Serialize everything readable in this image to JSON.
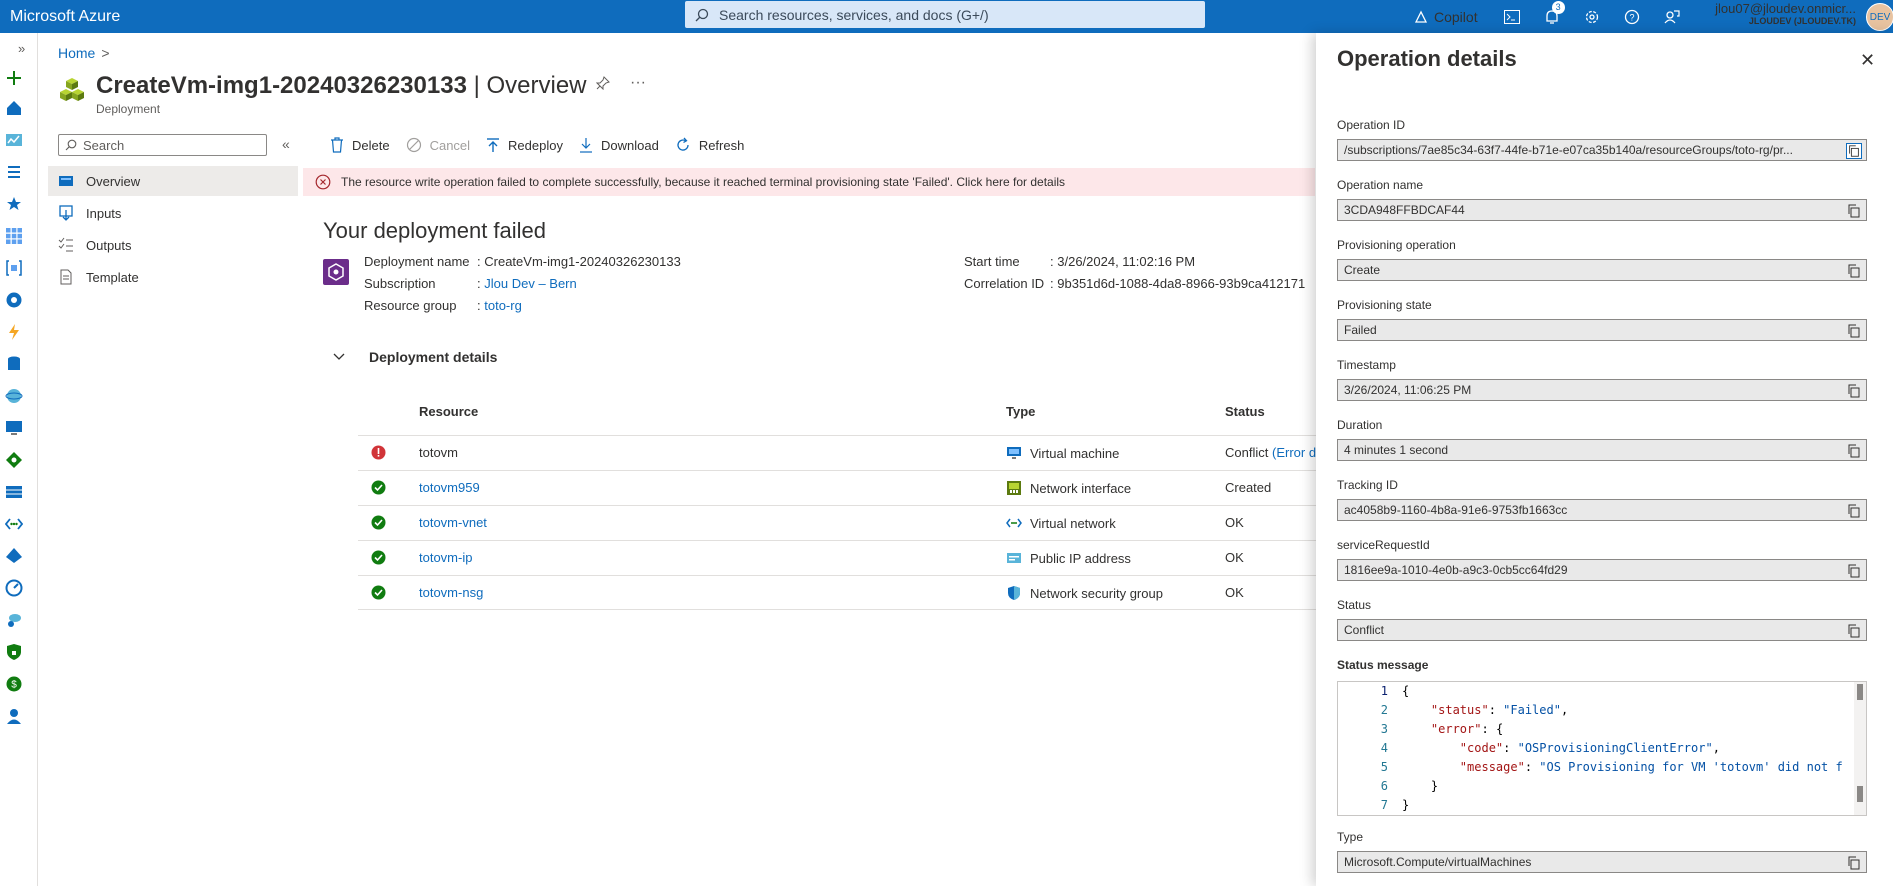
{
  "topbar": {
    "brand": "Microsoft Azure",
    "search_placeholder": "Search resources, services, and docs (G+/)",
    "copilot_label": "Copilot",
    "notification_count": "3",
    "account_user": "jlou07@jloudev.onmicr...",
    "account_tenant": "JLOUDEV (JLOUDEV.TK)",
    "avatar_text": "DEV"
  },
  "breadcrumb": {
    "home": "Home",
    "separator": ">"
  },
  "page": {
    "title_main": "CreateVm-img1-20240326230133",
    "title_suffix": " | Overview",
    "subtitle": "Deployment"
  },
  "leftnav": {
    "search_placeholder": "Search",
    "collapse": "«",
    "items": [
      {
        "label": "Overview",
        "icon": "overview-icon"
      },
      {
        "label": "Inputs",
        "icon": "inputs-icon"
      },
      {
        "label": "Outputs",
        "icon": "outputs-icon"
      },
      {
        "label": "Template",
        "icon": "template-icon"
      }
    ]
  },
  "toolbar": {
    "delete": "Delete",
    "cancel": "Cancel",
    "redeploy": "Redeploy",
    "download": "Download",
    "refresh": "Refresh"
  },
  "error_banner": "The resource write operation failed to complete successfully, because it reached terminal provisioning state 'Failed'. Click here for details",
  "main": {
    "heading": "Your deployment failed",
    "deployment_name_label": "Deployment name",
    "deployment_name": "CreateVm-img1-20240326230133",
    "subscription_label": "Subscription",
    "subscription": "Jlou Dev – Bern",
    "resource_group_label": "Resource group",
    "resource_group": "toto-rg",
    "start_time_label": "Start time",
    "start_time": "3/26/2024, 11:02:16 PM",
    "correlation_label": "Correlation ID",
    "correlation_id": "9b351d6d-1088-4da8-8966-93b9ca412171",
    "colon": ":"
  },
  "details": {
    "section_label": "Deployment details",
    "headers": {
      "resource": "Resource",
      "type": "Type",
      "status": "Status"
    },
    "rows": [
      {
        "resource": "totovm",
        "type": "Virtual machine",
        "status": "Conflict",
        "status_link": "(Error d",
        "state": "error"
      },
      {
        "resource": "totovm959",
        "type": "Network interface",
        "status": "Created",
        "status_link": "",
        "state": "ok"
      },
      {
        "resource": "totovm-vnet",
        "type": "Virtual network",
        "status": "OK",
        "status_link": "",
        "state": "ok"
      },
      {
        "resource": "totovm-ip",
        "type": "Public IP address",
        "status": "OK",
        "status_link": "",
        "state": "ok"
      },
      {
        "resource": "totovm-nsg",
        "type": "Network security group",
        "status": "OK",
        "status_link": "",
        "state": "ok"
      }
    ]
  },
  "panel": {
    "title": "Operation details",
    "fields": [
      {
        "label": "Operation ID",
        "value": "/subscriptions/7ae85c34-63f7-44fe-b71e-e07ca35b140a/resourceGroups/toto-rg/pr..."
      },
      {
        "label": "Operation name",
        "value": "3CDA948FFBDCAF44"
      },
      {
        "label": "Provisioning operation",
        "value": "Create"
      },
      {
        "label": "Provisioning state",
        "value": "Failed"
      },
      {
        "label": "Timestamp",
        "value": "3/26/2024, 11:06:25 PM"
      },
      {
        "label": "Duration",
        "value": "4 minutes 1 second"
      },
      {
        "label": "Tracking ID",
        "value": "ac4058b9-1160-4b8a-91e6-9753fb1663cc"
      },
      {
        "label": "serviceRequestId",
        "value": "1816ee9a-1010-4e0b-a9c3-0cb5cc64fd29"
      },
      {
        "label": "Status",
        "value": "Conflict"
      }
    ],
    "status_message_label": "Status message",
    "code_lines": [
      {
        "n": "1",
        "text": "{"
      },
      {
        "n": "2",
        "key": "\"status\"",
        "val": "\"Failed\"",
        "pre": "    ",
        "post": ","
      },
      {
        "n": "3",
        "key": "\"error\"",
        "val": "{",
        "pre": "    ",
        "post": ""
      },
      {
        "n": "4",
        "key": "\"code\"",
        "val": "\"OSProvisioningClientError\"",
        "pre": "        ",
        "post": ","
      },
      {
        "n": "5",
        "key": "\"message\"",
        "val": "\"OS Provisioning for VM 'totovm' did not f",
        "pre": "        ",
        "post": ""
      },
      {
        "n": "6",
        "text": "    }"
      },
      {
        "n": "7",
        "text": "}"
      }
    ],
    "type_label": "Type",
    "type_value": "Microsoft.Compute/virtualMachines"
  },
  "colors": {
    "accent": "#0f6cbd",
    "error": "#d13438",
    "success": "#107c10"
  }
}
